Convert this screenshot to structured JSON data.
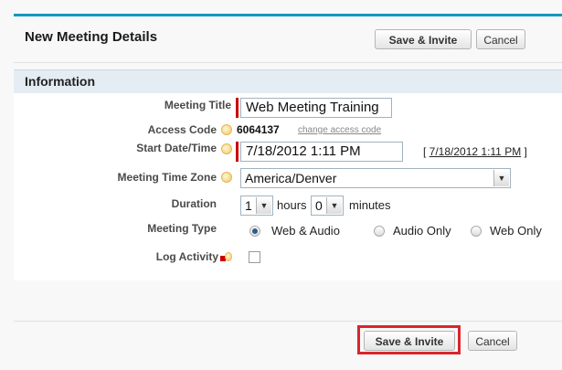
{
  "header": {
    "title": "New Meeting Details",
    "save_label": "Save & Invite",
    "cancel_label": "Cancel"
  },
  "section": {
    "title": "Information"
  },
  "fields": {
    "meeting_title": {
      "label": "Meeting Title",
      "value": "Web Meeting Training",
      "required": true
    },
    "access_code": {
      "label": "Access Code",
      "value": "6064137",
      "link": "change access code"
    },
    "start_datetime": {
      "label": "Start Date/Time",
      "value": "7/18/2012 1:11 PM",
      "required": true,
      "link_prefix": "[ ",
      "link": "7/18/2012 1:11 PM",
      "link_suffix": " ]"
    },
    "time_zone": {
      "label": "Meeting Time Zone",
      "value": "America/Denver"
    },
    "duration": {
      "label": "Duration",
      "hours_value": "1",
      "hours_label": "hours",
      "minutes_value": "0",
      "minutes_label": "minutes"
    },
    "meeting_type": {
      "label": "Meeting Type",
      "options": [
        "Web & Audio",
        "Audio Only",
        "Web Only"
      ],
      "selected": "Web & Audio"
    },
    "log_activity": {
      "label": "Log Activity",
      "checked": false
    }
  },
  "footer": {
    "save_label": "Save & Invite",
    "cancel_label": "Cancel",
    "highlight_color": "#d9262c"
  },
  "icons": {
    "help": "help-bubble-icon",
    "dropdown": "chevron-down-icon"
  }
}
